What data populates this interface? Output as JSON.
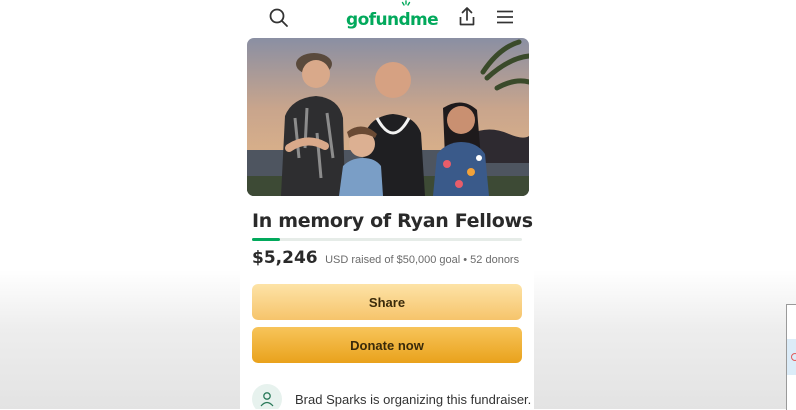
{
  "header": {
    "brand": "gofundme",
    "brand_color": "#02a95c",
    "icons": [
      "search-icon",
      "share-upload-icon",
      "menu-icon"
    ]
  },
  "campaign": {
    "title": "In memory of Ryan Fellows",
    "amount_raised": "$5,246",
    "raised_detail": "USD raised of $50,000 goal • 52 donors",
    "progress_fraction": 0.105
  },
  "buttons": {
    "share_label": "Share",
    "donate_label": "Donate now"
  },
  "organizer": {
    "text": "Brad Sparks is organizing this fundraiser."
  },
  "colors": {
    "share_button": "#f6c46b",
    "donate_button": "#e9a21c"
  }
}
